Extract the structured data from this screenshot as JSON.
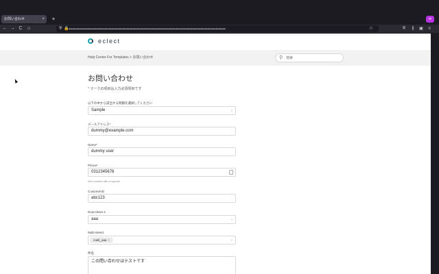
{
  "browser": {
    "tab_title": "お問い合わせ",
    "tab_close": "×",
    "new_tab": "+",
    "nav_back": "←",
    "nav_forward": "→",
    "nav_reload": "C",
    "nav_home": "⌂",
    "url_shield": "⛨",
    "url_lock": "🔒",
    "url_masked": "▬▬▬▬▬▬▬▬▬▬▬▬▬▬▬▬▬▬▬▬▬▬▬▬▬▬▬▬▬▬▬▬▬▬▬▬▬▬▬▬▬▬▬▬",
    "star": "☆",
    "ext_badge": "∞",
    "tools": [
      "⛨",
      "⫼",
      "▣",
      "≡"
    ]
  },
  "header": {
    "logo_text": "eclect",
    "brand_color": "#1b9fb3"
  },
  "subnav": {
    "breadcrumb": "Help Center For Templates  >  お問い合わせ",
    "search_placeholder": "検索",
    "search_icon": "⚲"
  },
  "form": {
    "title": "お問い合わせ",
    "required_note": "* マークの項目は入力必須項目です",
    "select_arrow": "⌄",
    "fields": [
      {
        "label": "以下の中から該当する問題を選択してください",
        "value": "Sample"
      },
      {
        "label": "メールアドレス*",
        "value": "dummy@example.com"
      },
      {
        "label": "Name*",
        "value": "dummy user"
      },
      {
        "label": "Phone*",
        "value": "0312345678",
        "hint": "Not connect with a hyphen"
      },
      {
        "label": "CustomerID",
        "value": "abc123"
      },
      {
        "label": "Drop-down-1",
        "value": "aaa"
      },
      {
        "label": "Multi-Select",
        "chip": "multi_aaa",
        "chip_remove": "×"
      },
      {
        "label": "件名",
        "value": "この問い合わせはテストです"
      }
    ]
  }
}
